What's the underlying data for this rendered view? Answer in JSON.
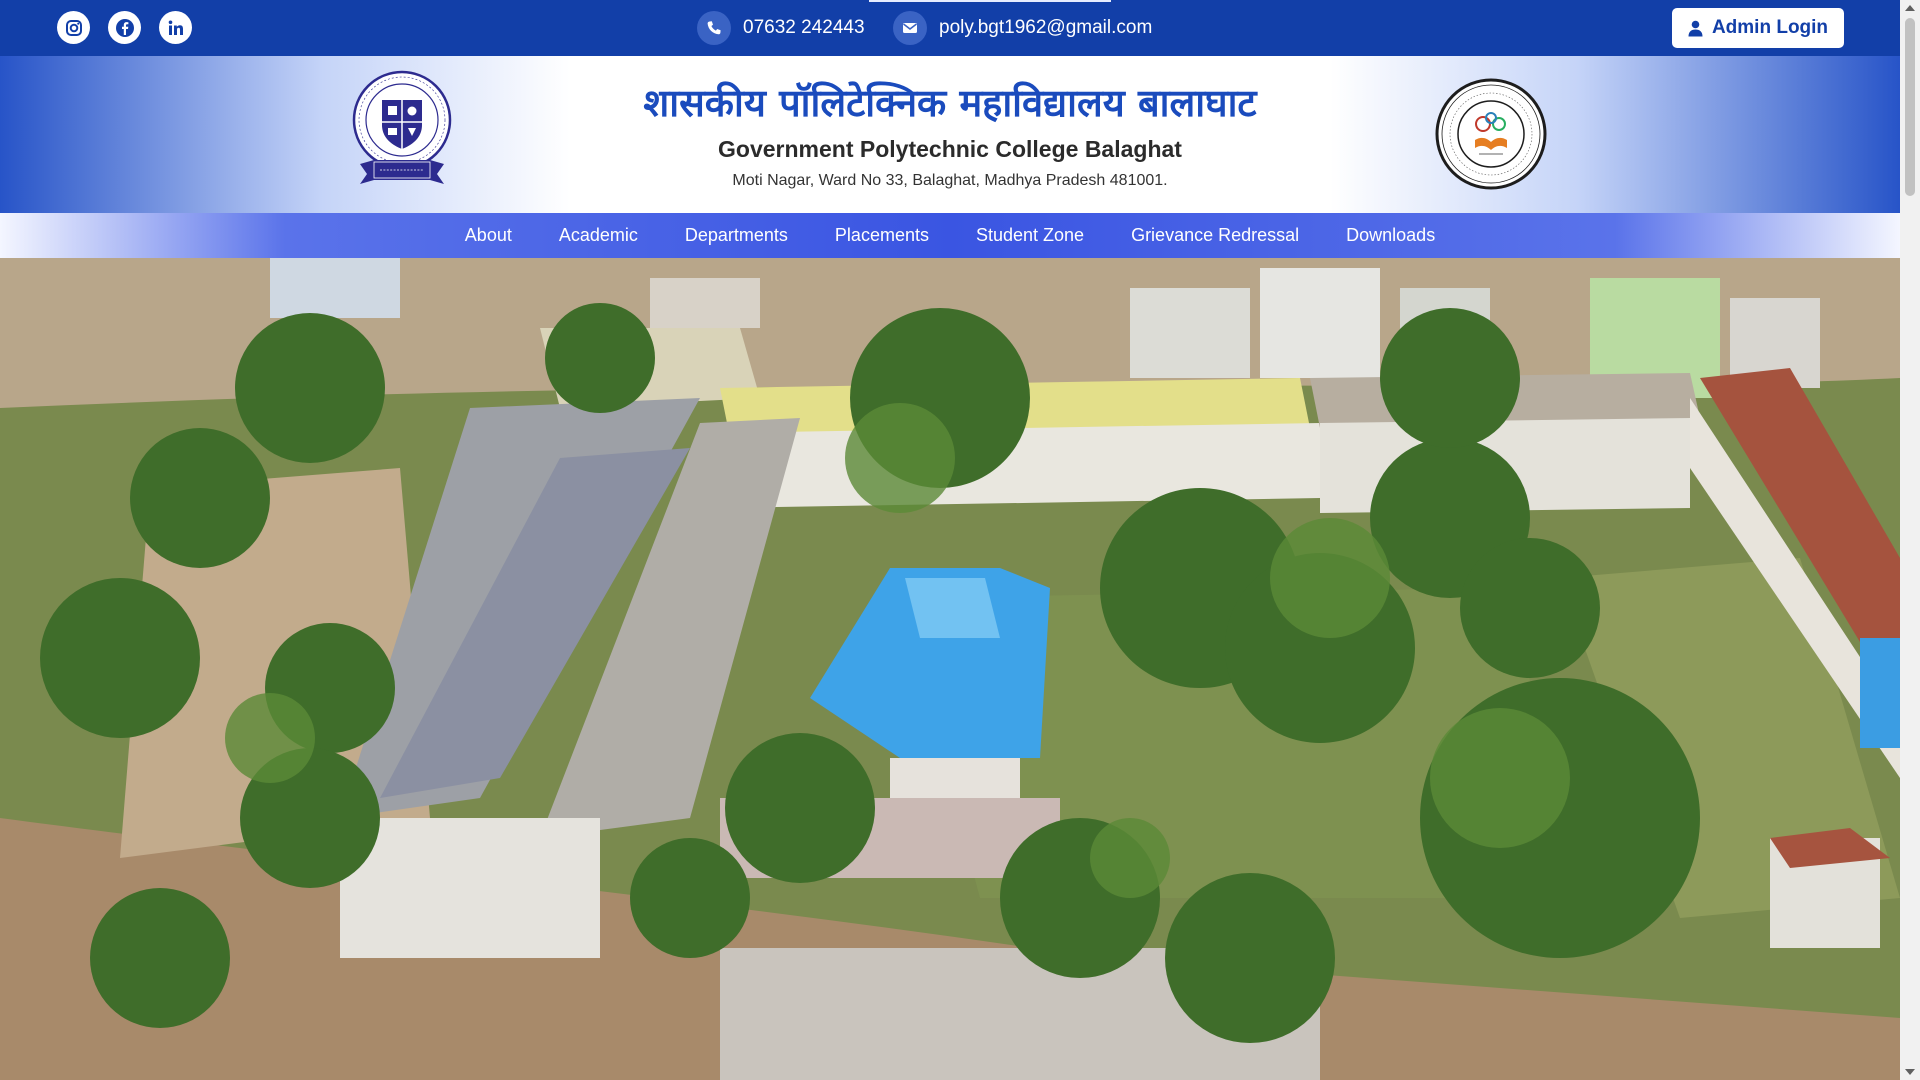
{
  "topbar": {
    "social": [
      {
        "name": "instagram-icon"
      },
      {
        "name": "facebook-icon"
      },
      {
        "name": "linkedin-icon"
      }
    ],
    "phone": "07632 242443",
    "email": "poly.bgt1962@gmail.com",
    "admin_label": "Admin Login"
  },
  "header": {
    "title_hindi": "शासकीय पॉलिटेक्निक महाविद्यालय बालाघाट",
    "title_english": "Government Polytechnic College Balaghat",
    "address": "Moti Nagar, Ward No 33, Balaghat, Madhya Pradesh 481001.",
    "logo_left_motto": "स्वयं सिद्धि मयं विद्या",
    "logo_right_text": "DIRECTORATE OF TECHNICAL EDUCATION MADHYA PRADESH"
  },
  "nav": {
    "items": [
      {
        "label": "About"
      },
      {
        "label": "Academic"
      },
      {
        "label": "Departments"
      },
      {
        "label": "Placements"
      },
      {
        "label": "Student Zone"
      },
      {
        "label": "Grievance Redressal"
      },
      {
        "label": "Downloads"
      }
    ]
  },
  "colors": {
    "brand": "#123fa8",
    "nav": "#3a55e2",
    "title": "#1a4bbd"
  }
}
